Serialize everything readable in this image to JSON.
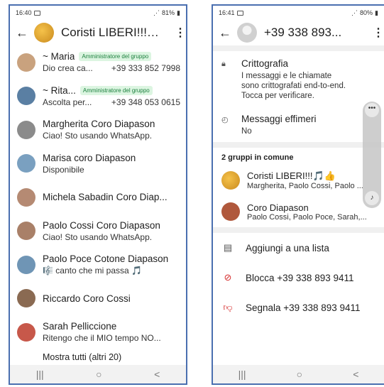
{
  "left": {
    "status": {
      "time": "16:40",
      "battery": "81%"
    },
    "header": {
      "title": "Coristi LIBERI!!!🎵..."
    },
    "members": [
      {
        "name": "~ Maria",
        "badge": "Amministratore del gruppo",
        "status": "Dio crea ca...",
        "phone": "+39 333 852 7998",
        "color": "#c9a27e"
      },
      {
        "name": "~ Rita...",
        "badge": "Amministratore del gruppo",
        "status": "Ascolta per...",
        "phone": "+39 348 053 0615",
        "color": "#5a7fa3"
      },
      {
        "name": "Margherita Coro Diapason",
        "badge": "",
        "status": "Ciao! Sto usando WhatsApp.",
        "phone": "",
        "color": "#8b8b8b"
      },
      {
        "name": "Marisa coro Diapason",
        "badge": "",
        "status": "Disponibile",
        "phone": "",
        "color": "#7aa0c0"
      },
      {
        "name": "Michela Sabadin Coro Diap...",
        "badge": "",
        "status": "",
        "phone": "",
        "color": "#b58a73"
      },
      {
        "name": "Paolo Cossi Coro Diapason",
        "badge": "",
        "status": "Ciao! Sto usando WhatsApp.",
        "phone": "",
        "color": "#a98068"
      },
      {
        "name": "Paolo Poce Cotone Diapason",
        "badge": "",
        "status": "🎼 canto che mi passa 🎵",
        "phone": "",
        "color": "#6f95b5"
      },
      {
        "name": "Riccardo Coro Cossi",
        "badge": "",
        "status": "",
        "phone": "",
        "color": "#8a6a52"
      },
      {
        "name": "Sarah Pelliccione",
        "badge": "",
        "status": "Ritengo che il MIO tempo NO...",
        "phone": "",
        "color": "#c7584a"
      }
    ],
    "show_all": "Mostra tutti (altri 20)"
  },
  "right": {
    "status": {
      "time": "16:41",
      "battery": "80%"
    },
    "header": {
      "title": "+39 338 893..."
    },
    "encryption": {
      "title": "Crittografia",
      "line1": "I messaggi e le chiamate",
      "line2": "sono crittografati end-to-end.",
      "line3": "Tocca per verificare."
    },
    "ephemeral": {
      "title": "Messaggi effimeri",
      "value": "No"
    },
    "groups_header": "2 gruppi in comune",
    "groups": [
      {
        "name": "Coristi LIBERI!!!🎵👍",
        "members": "Margherita, Paolo Cossi, Paolo ...",
        "color": "#d49a3a"
      },
      {
        "name": "Coro Diapason",
        "members": "Paolo Cossi, Paolo Poce, Sarah,...",
        "color": "#b0583c"
      }
    ],
    "actions": {
      "add_list": "Aggiungi a una lista",
      "block": "Blocca +39 338 893 9411",
      "report": "Segnala +39 338 893 9411"
    }
  },
  "navbar": {
    "recents": "|||",
    "home": "○",
    "back": "<"
  }
}
